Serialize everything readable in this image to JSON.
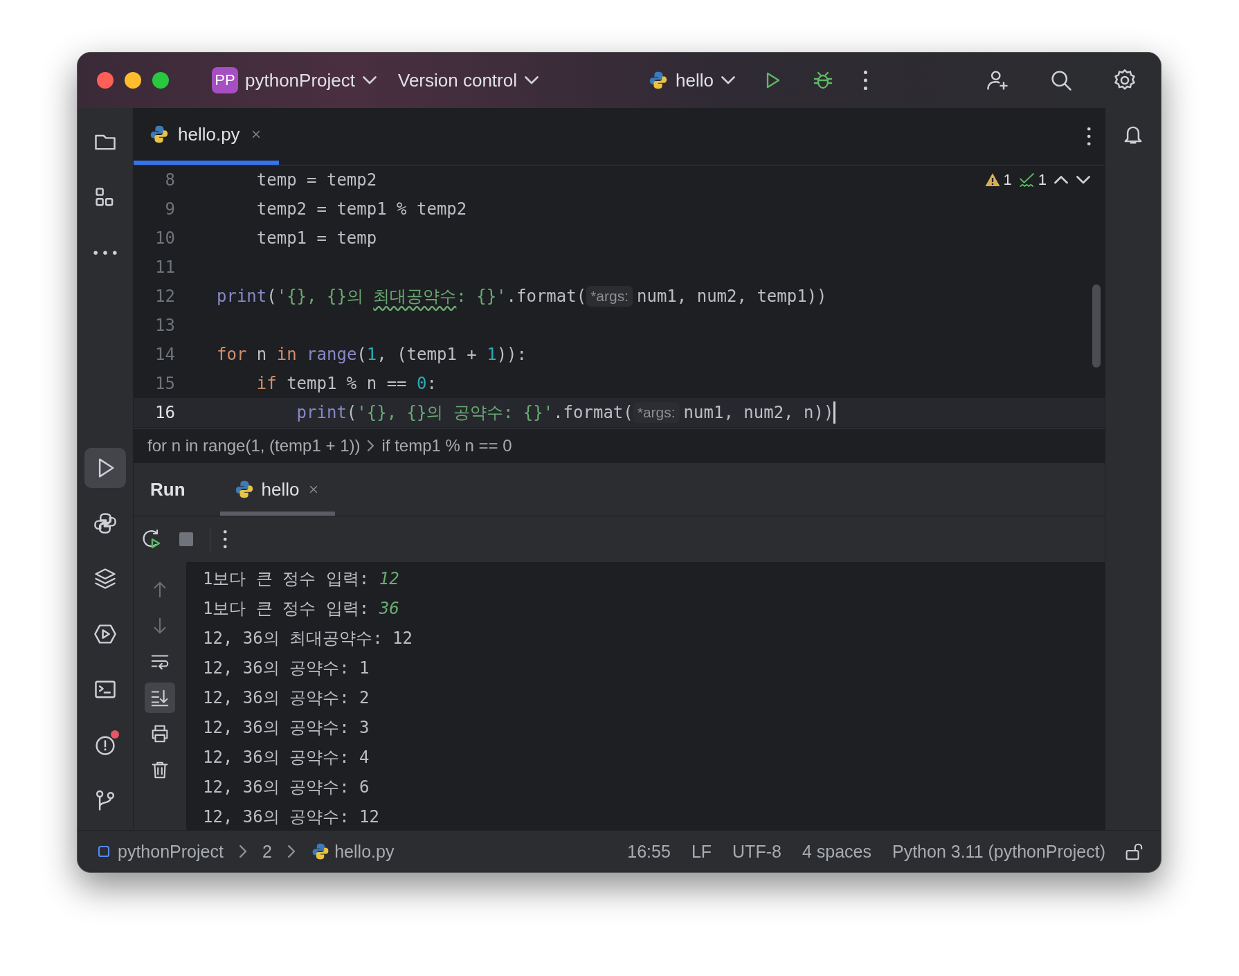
{
  "window": {
    "project_badge": "PP",
    "project": "pythonProject",
    "vcs": "Version control",
    "run_config": "hello"
  },
  "left_toolbar": {
    "top": [
      {
        "kind": "folder",
        "selected": false
      },
      {
        "kind": "structure",
        "selected": false
      },
      {
        "kind": "more",
        "selected": false
      }
    ],
    "bottom": [
      {
        "kind": "run",
        "selected": true
      },
      {
        "kind": "python-console",
        "selected": false
      },
      {
        "kind": "layers",
        "selected": false
      },
      {
        "kind": "services",
        "selected": false
      },
      {
        "kind": "terminal",
        "selected": false
      },
      {
        "kind": "problems",
        "selected": false,
        "alert": true
      },
      {
        "kind": "git",
        "selected": false
      }
    ]
  },
  "editor_tabs": [
    {
      "label": "hello.py",
      "selected": true
    }
  ],
  "inspections": {
    "warnings": "1",
    "typos": "1"
  },
  "code_lines": [
    {
      "number": "8",
      "current": false,
      "tokens": [
        {
          "kind": "plain",
          "text": "    temp = temp2"
        }
      ]
    },
    {
      "number": "9",
      "current": false,
      "tokens": [
        {
          "kind": "plain",
          "text": "    temp2 = temp1 % temp2"
        }
      ]
    },
    {
      "number": "10",
      "current": false,
      "tokens": [
        {
          "kind": "plain",
          "text": "    temp1 = temp"
        }
      ]
    },
    {
      "number": "11",
      "current": false
    },
    {
      "number": "12",
      "current": false,
      "tokens": [
        {
          "kind": "func",
          "text": "print"
        },
        {
          "kind": "plain",
          "text": "("
        },
        {
          "kind": "string",
          "text": "'{}, {}의 "
        },
        {
          "kind": "typo",
          "text": "최대공약수"
        },
        {
          "kind": "string",
          "text": ": {}'"
        },
        {
          "kind": "plain",
          "text": ".format("
        },
        {
          "kind": "hint",
          "text": "*args:"
        },
        {
          "kind": "plain",
          "text": "num1, num2, temp1))"
        }
      ]
    },
    {
      "number": "13",
      "current": false
    },
    {
      "number": "14",
      "current": false,
      "tokens": [
        {
          "kind": "keyword",
          "text": "for"
        },
        {
          "kind": "plain",
          "text": " n "
        },
        {
          "kind": "keyword",
          "text": "in "
        },
        {
          "kind": "func",
          "text": "range"
        },
        {
          "kind": "plain",
          "text": "("
        },
        {
          "kind": "number",
          "text": "1"
        },
        {
          "kind": "plain",
          "text": ", (temp1 + "
        },
        {
          "kind": "number",
          "text": "1"
        },
        {
          "kind": "plain",
          "text": ")):"
        }
      ]
    },
    {
      "number": "15",
      "current": false,
      "tokens": [
        {
          "kind": "keyword",
          "text": "    if"
        },
        {
          "kind": "plain",
          "text": " temp1 % n == "
        },
        {
          "kind": "number",
          "text": "0"
        },
        {
          "kind": "plain",
          "text": ":"
        }
      ]
    },
    {
      "number": "16",
      "current": true,
      "tokens": [
        {
          "kind": "func",
          "text": "        print"
        },
        {
          "kind": "plain",
          "text": "("
        },
        {
          "kind": "string",
          "text": "'{}, {}의 공약수: {}'"
        },
        {
          "kind": "plain",
          "text": ".format("
        },
        {
          "kind": "hint",
          "text": "*args:"
        },
        {
          "kind": "plain",
          "text": "num1, num2, n))"
        }
      ]
    }
  ],
  "breadcrumbs": [
    "for n in range(1, (temp1 + 1))",
    "if temp1 % n == 0"
  ],
  "run_panel": {
    "title": "Run",
    "tabs": [
      {
        "label": "hello",
        "selected": true
      }
    ],
    "side_tools": [
      {
        "kind": "up",
        "disabled": true,
        "on": false
      },
      {
        "kind": "down",
        "disabled": true,
        "on": false
      },
      {
        "kind": "wrap",
        "disabled": false,
        "on": false
      },
      {
        "kind": "scroll-end",
        "disabled": false,
        "on": true
      },
      {
        "kind": "print",
        "disabled": false,
        "on": false
      },
      {
        "kind": "trash",
        "disabled": false,
        "on": false
      }
    ],
    "output": [
      [
        {
          "kind": "out",
          "text": "1보다 큰 정수 입력: "
        },
        {
          "kind": "input",
          "text": "12"
        }
      ],
      [
        {
          "kind": "out",
          "text": "1보다 큰 정수 입력: "
        },
        {
          "kind": "input",
          "text": "36"
        }
      ],
      [
        {
          "kind": "out",
          "text": "12, 36의 최대공약수: 12"
        }
      ],
      [
        {
          "kind": "out",
          "text": "12, 36의 공약수: 1"
        }
      ],
      [
        {
          "kind": "out",
          "text": "12, 36의 공약수: 2"
        }
      ],
      [
        {
          "kind": "out",
          "text": "12, 36의 공약수: 3"
        }
      ],
      [
        {
          "kind": "out",
          "text": "12, 36의 공약수: 4"
        }
      ],
      [
        {
          "kind": "out",
          "text": "12, 36의 공약수: 6"
        }
      ],
      [
        {
          "kind": "out",
          "text": "12, 36의 공약수: 12"
        }
      ]
    ]
  },
  "status_bar": {
    "path": [
      {
        "kind": "project",
        "text": "pythonProject"
      },
      {
        "kind": "folder",
        "text": "2"
      },
      {
        "kind": "file",
        "text": "hello.py"
      }
    ],
    "items": [
      "16:55",
      "LF",
      "UTF-8",
      "4 spaces",
      "Python 3.11 (pythonProject)"
    ]
  }
}
